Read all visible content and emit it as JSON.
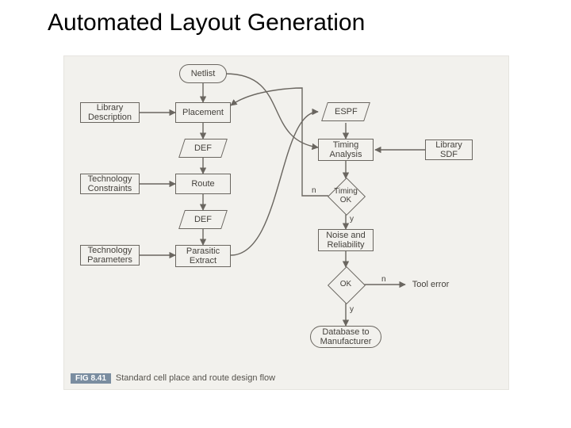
{
  "title": "Automated Layout Generation",
  "figure": {
    "tag": "FIG 8.41",
    "caption": "Standard cell place and route design flow"
  },
  "nodes": {
    "netlist": "Netlist",
    "library_desc": "Library\nDescription",
    "placement": "Placement",
    "def1": "DEF",
    "tech_constraints": "Technology\nConstraints",
    "route": "Route",
    "def2": "DEF",
    "tech_params": "Technology\nParameters",
    "parasitic": "Parasitic\nExtract",
    "espf": "ESPF",
    "timing_analysis": "Timing\nAnalysis",
    "library_sdf": "Library\nSDF",
    "timing_ok": "Timing\nOK",
    "noise": "Noise and\nReliability",
    "ok": "OK",
    "tool_error": "Tool error",
    "db": "Database to\nManufacturer"
  },
  "edge_labels": {
    "timing_ok_n": "n",
    "timing_ok_y": "y",
    "ok_n": "n",
    "ok_y": "y"
  }
}
